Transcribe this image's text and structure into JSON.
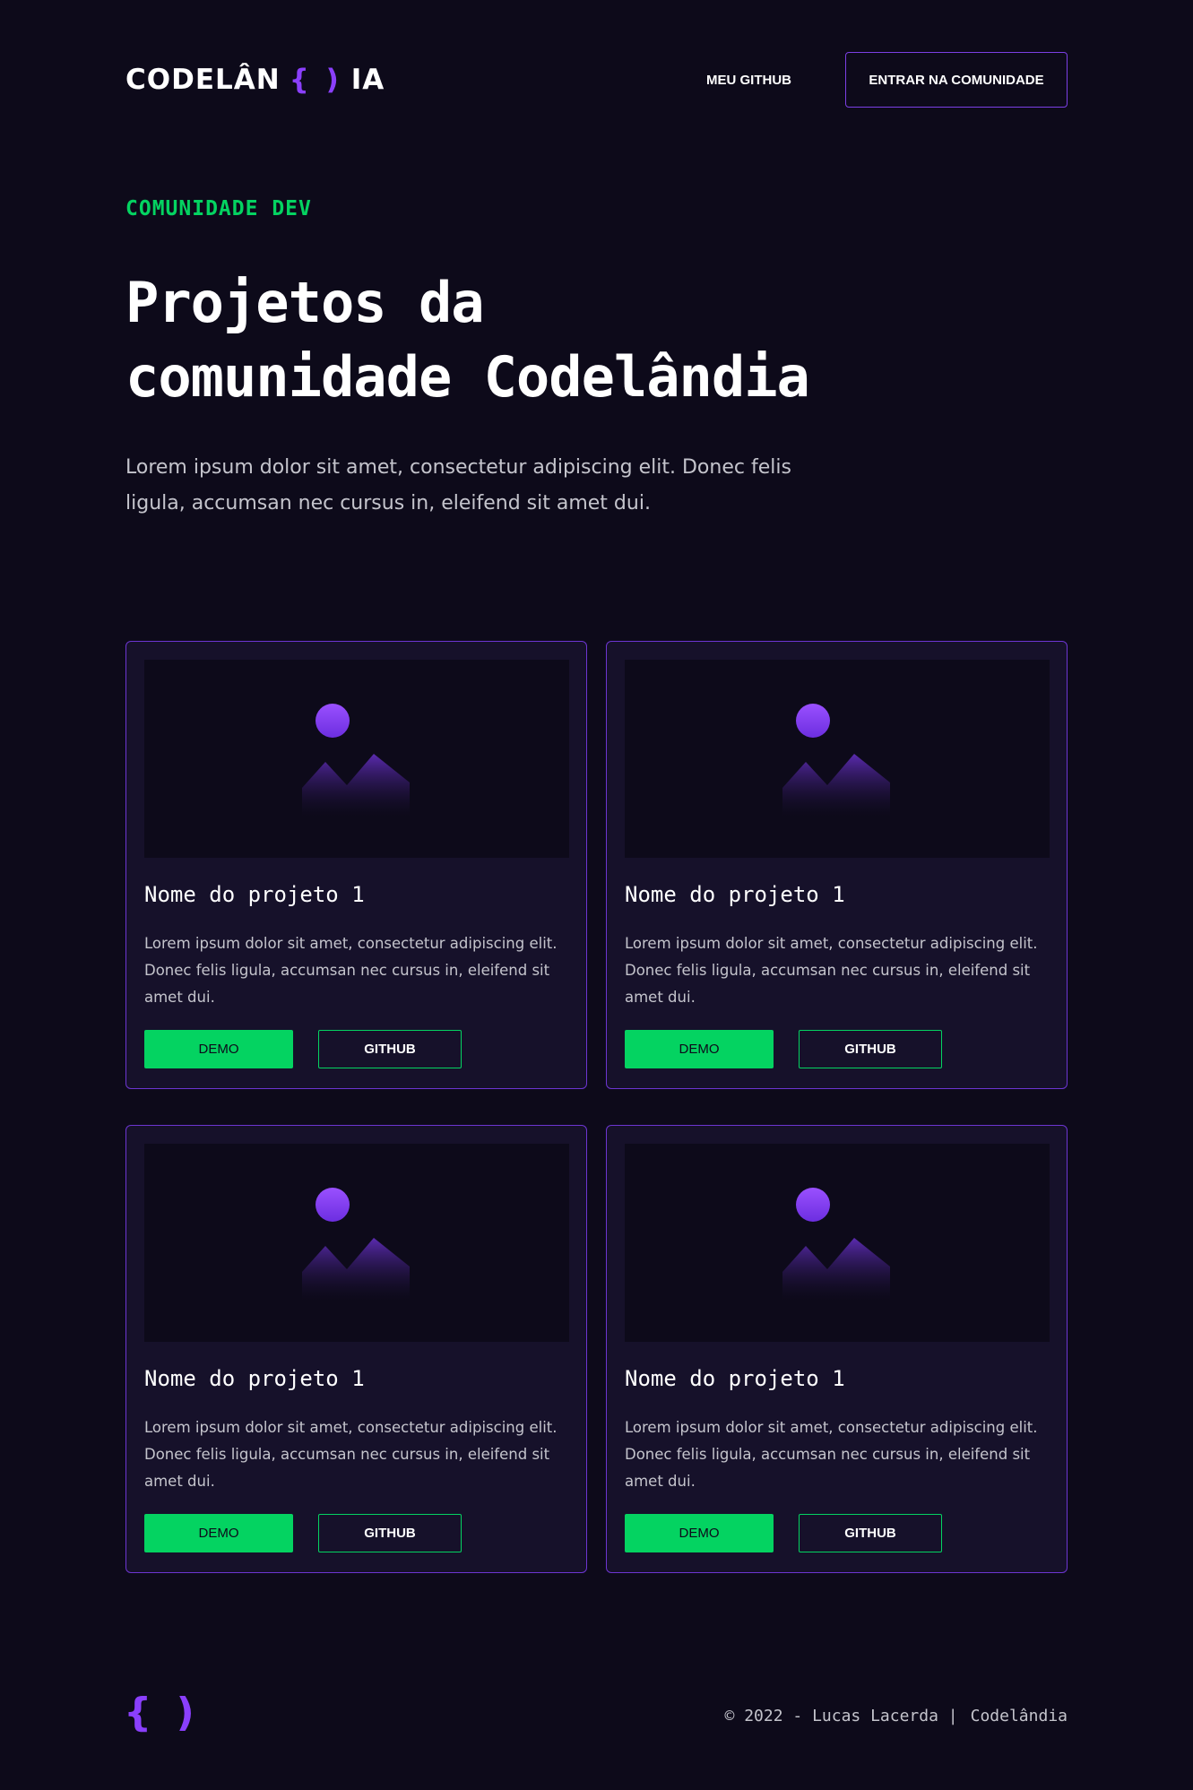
{
  "header": {
    "logo_left": "CODELÂN",
    "logo_brace": "{ )",
    "logo_right": "IA",
    "nav_github": "MEU GITHUB",
    "nav_cta": "ENTRAR NA COMUNIDADE"
  },
  "hero": {
    "eyebrow": "COMUNIDADE DEV",
    "title_line1": "Projetos da",
    "title_line2": "comunidade Codelândia",
    "description": "Lorem ipsum dolor sit amet, consectetur adipiscing elit. Donec felis ligula, accumsan nec cursus in, eleifend sit amet dui."
  },
  "projects": [
    {
      "title": "Nome do projeto 1",
      "description": "Lorem ipsum dolor sit amet, consectetur adipiscing elit. Donec felis ligula, accumsan nec cursus in, eleifend sit amet dui.",
      "demo_label": "DEMO",
      "github_label": "GITHUB"
    },
    {
      "title": "Nome do projeto 1",
      "description": "Lorem ipsum dolor sit amet, consectetur adipiscing elit. Donec felis ligula, accumsan nec cursus in, eleifend sit amet dui.",
      "demo_label": "DEMO",
      "github_label": "GITHUB"
    },
    {
      "title": "Nome do projeto 1",
      "description": "Lorem ipsum dolor sit amet, consectetur adipiscing elit. Donec felis ligula, accumsan nec cursus in, eleifend sit amet dui.",
      "demo_label": "DEMO",
      "github_label": "GITHUB"
    },
    {
      "title": "Nome do projeto 1",
      "description": "Lorem ipsum dolor sit amet, consectetur adipiscing elit. Donec felis ligula, accumsan nec cursus in, eleifend sit amet dui.",
      "demo_label": "DEMO",
      "github_label": "GITHUB"
    }
  ],
  "footer": {
    "logo": "{ )",
    "copyright": "© 2022 - Lucas Lacerda |",
    "brand": "Codelândia"
  },
  "icons": {
    "project_image": "image-placeholder-icon"
  },
  "colors": {
    "background": "#0d0a1a",
    "card_background": "#16112a",
    "accent_purple": "#8a3ffc",
    "accent_green": "#04d361",
    "text_muted": "#c4c4cc"
  }
}
